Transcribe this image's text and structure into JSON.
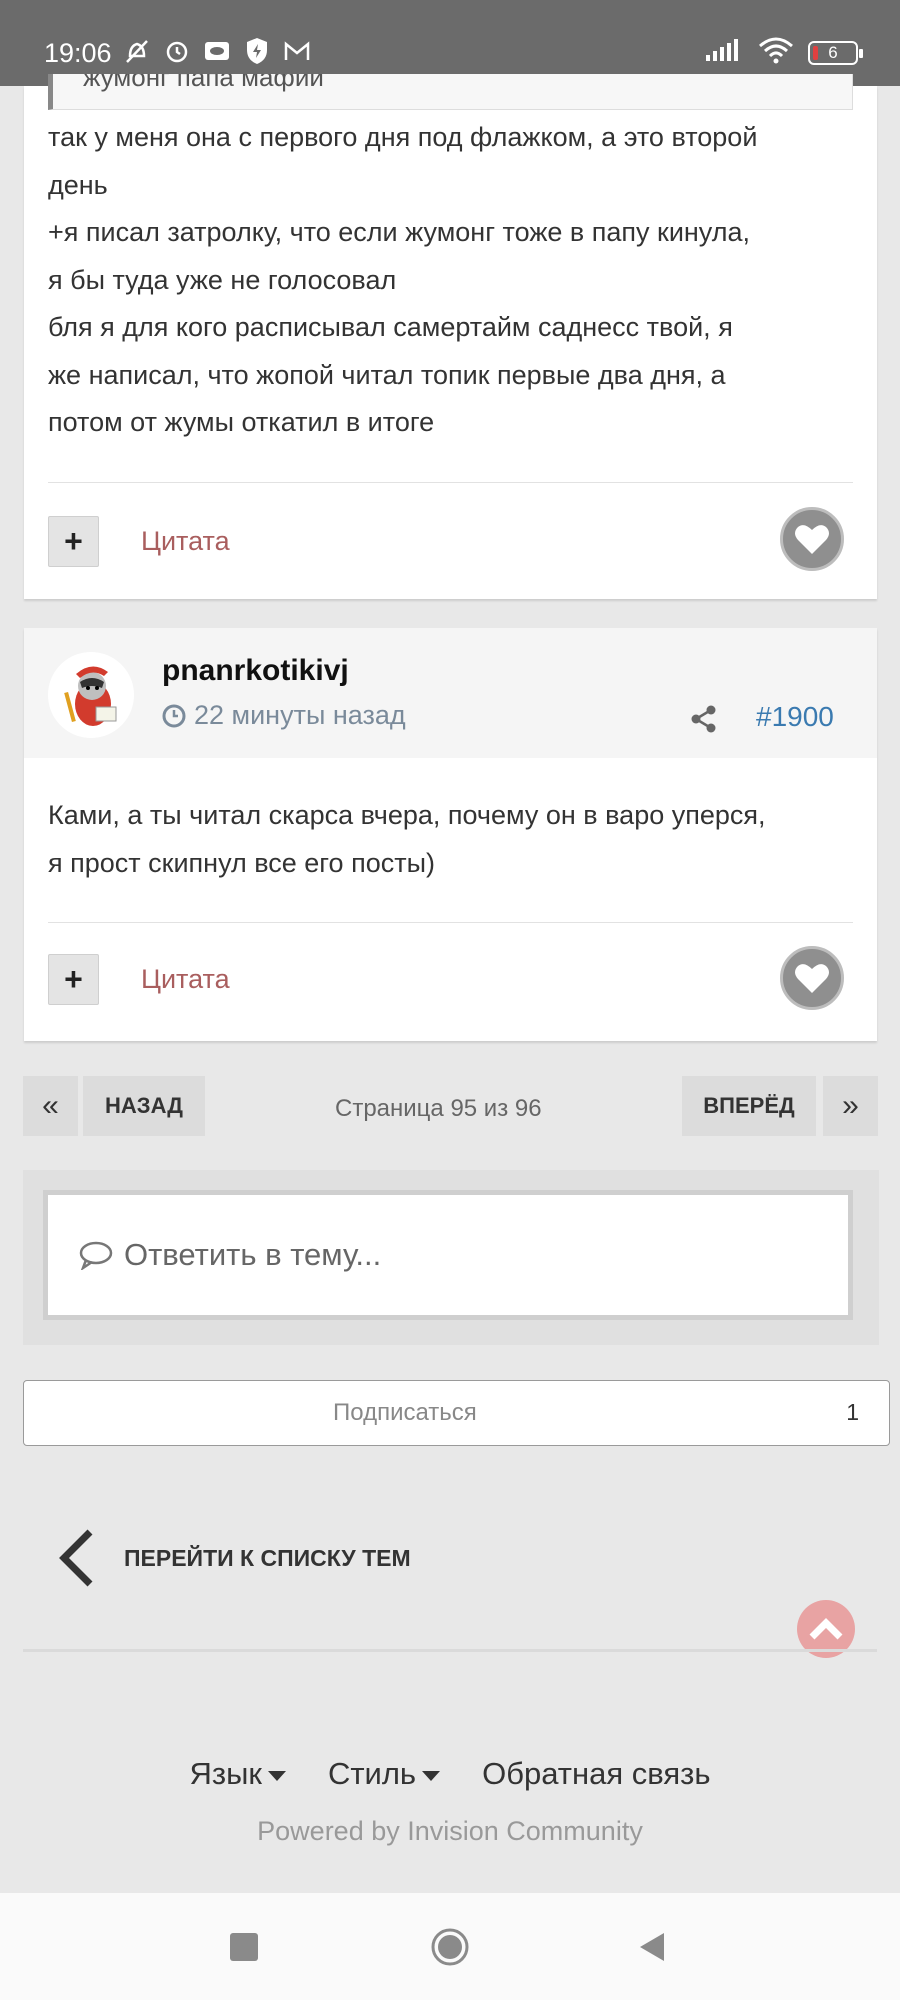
{
  "status_bar": {
    "time": "19:06",
    "battery_level": "6",
    "icons_left": [
      "alarm-off-icon",
      "alarm-icon",
      "cast-icon",
      "vpn-shield-icon",
      "gmail-icon"
    ],
    "icons_right": [
      "signal-icon",
      "wifi-icon",
      "battery-icon"
    ]
  },
  "post1": {
    "quote_fragment": "жумонг папа мафии",
    "lines": [
      "так у меня она с первого дня под флажком, а это второй",
      "день",
      "+я писал затролку, что если жумонг тоже в папу кинула,",
      "я бы туда уже не голосовал",
      "бля я для кого расписывал самертайм саднесс твой, я",
      "же написал, что жопой читал топик первые два дня, а",
      "потом от жумы откатил в итоге"
    ],
    "plus_label": "+",
    "quote_label": "Цитата"
  },
  "post2": {
    "author": "pnanrkotikivj",
    "time": "22 минуты назад",
    "post_number": "#1900",
    "lines": [
      "Ками, а ты читал скарса вчера, почему он в варо уперся,",
      "я прост скипнул все его посты)"
    ],
    "plus_label": "+",
    "quote_label": "Цитата"
  },
  "pagination": {
    "first_label": "«",
    "prev_label": "НАЗАД",
    "page_info": "Страница 95 из 96",
    "next_label": "ВПЕРЁД",
    "last_label": "»"
  },
  "reply": {
    "placeholder": "Ответить в тему..."
  },
  "subscribe": {
    "label": "Подписаться",
    "count": "1"
  },
  "goto_list": {
    "label": "ПЕРЕЙТИ К СПИСКУ ТЕМ"
  },
  "footer": {
    "language": "Язык",
    "style": "Стиль",
    "feedback": "Обратная связь",
    "powered_by": "Powered by Invision Community"
  },
  "colors": {
    "quote_link": "#a95e5e",
    "post_number": "#3a7ab0",
    "scroll_top": "#e8a3a3"
  }
}
